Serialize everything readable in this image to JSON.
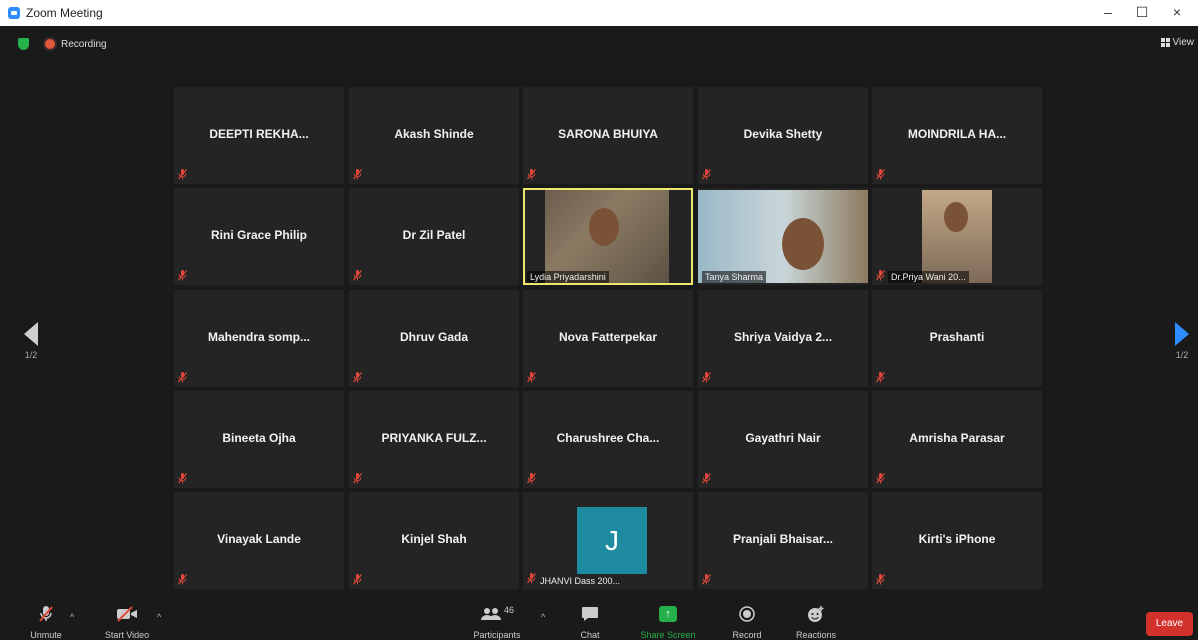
{
  "window": {
    "title": "Zoom Meeting",
    "minimize": "–",
    "maximize": "☐",
    "close": "×"
  },
  "topbar": {
    "recording_label": "Recording",
    "view_label": "View"
  },
  "pager": {
    "left": "1/2",
    "right": "1/2"
  },
  "participants": [
    "DEEPTI REKHA...",
    "Akash Shinde",
    "SARONA BHUIYA",
    "Devika Shetty",
    "MOINDRILA HA...",
    "Rini Grace Philip",
    "Dr Zil Patel",
    "Lydia Priyadarshini",
    "Tanya Sharma",
    "Dr.Priya Wani 20...",
    "Mahendra somp...",
    "Dhruv Gada",
    "Nova Fatterpekar",
    "Shriya Vaidya 2...",
    "Prashanti",
    "Bineeta Ojha",
    "PRIYANKA FULZ...",
    "Charushree Cha...",
    "Gayathri Nair",
    "Amrisha Parasar",
    "Vinayak Lande",
    "Kinjel Shah",
    "JHANVI Dass 200...",
    "Pranjali Bhaisar...",
    "Kirti's iPhone"
  ],
  "avatar_letter": "J",
  "toolbar": {
    "unmute": "Unmute",
    "start_video": "Start Video",
    "participants": "Participants",
    "participants_count": "46",
    "chat": "Chat",
    "share_screen": "Share Screen",
    "record": "Record",
    "reactions": "Reactions",
    "leave": "Leave"
  },
  "colors": {
    "accent": "#2d8cff",
    "share": "#25b04a",
    "leave": "#d3322c",
    "active_speaker": "#f0e86a",
    "muted": "#e0473a"
  }
}
